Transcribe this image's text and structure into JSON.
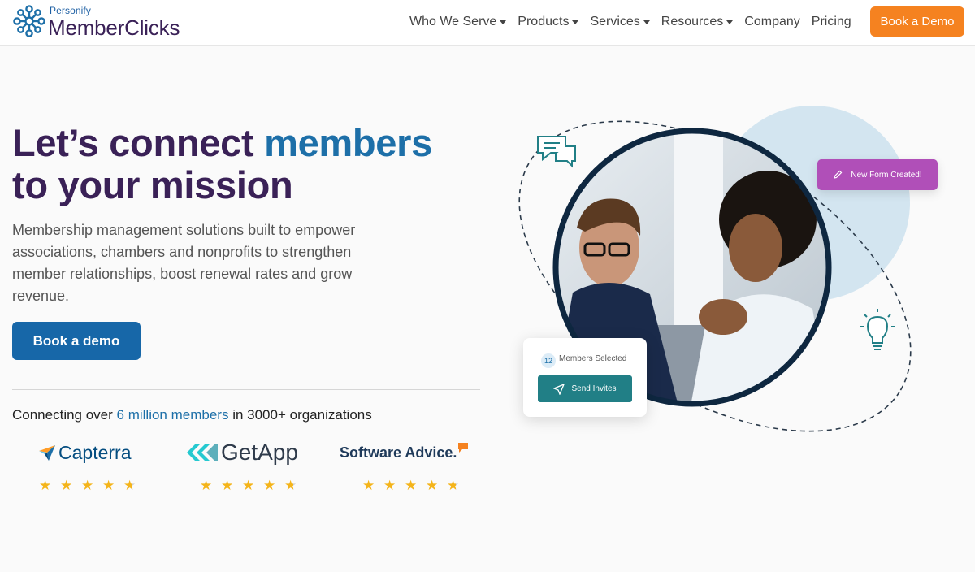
{
  "brand": {
    "personify": "Personify",
    "name": "MemberClicks"
  },
  "nav": {
    "items": [
      {
        "label": "Who We Serve",
        "dropdown": true
      },
      {
        "label": "Products",
        "dropdown": true
      },
      {
        "label": "Services",
        "dropdown": true
      },
      {
        "label": "Resources",
        "dropdown": true
      },
      {
        "label": "Company",
        "dropdown": false
      },
      {
        "label": "Pricing",
        "dropdown": false
      }
    ],
    "cta_label": "Book a Demo"
  },
  "hero": {
    "title_part1": "Let’s connect ",
    "title_accent": "members",
    "title_part2": "to your mission",
    "subtitle": "Membership management solutions built to empower associations, chambers and nonprofits to strengthen member relationships, boost renewal rates and grow revenue.",
    "cta_label": "Book a demo",
    "stats_prefix": "Connecting over ",
    "stats_highlight": "6 million members",
    "stats_suffix": " in 3000+ organizations"
  },
  "reviews": [
    {
      "name": "Capterra",
      "rating": 4.5
    },
    {
      "name": "GetApp",
      "rating": 4.5
    },
    {
      "name": "Software Advice.",
      "rating": 4.5
    }
  ],
  "visual": {
    "members_count": "12",
    "members_label": "Members Selected",
    "send_label": "Send Invites",
    "form_label": "New Form Created!"
  },
  "colors": {
    "brand_purple": "#3a2157",
    "brand_blue": "#1d6fa8",
    "cta_orange": "#f58220",
    "teal": "#217f86",
    "magenta": "#b04fb8",
    "star": "#f4b41a"
  }
}
